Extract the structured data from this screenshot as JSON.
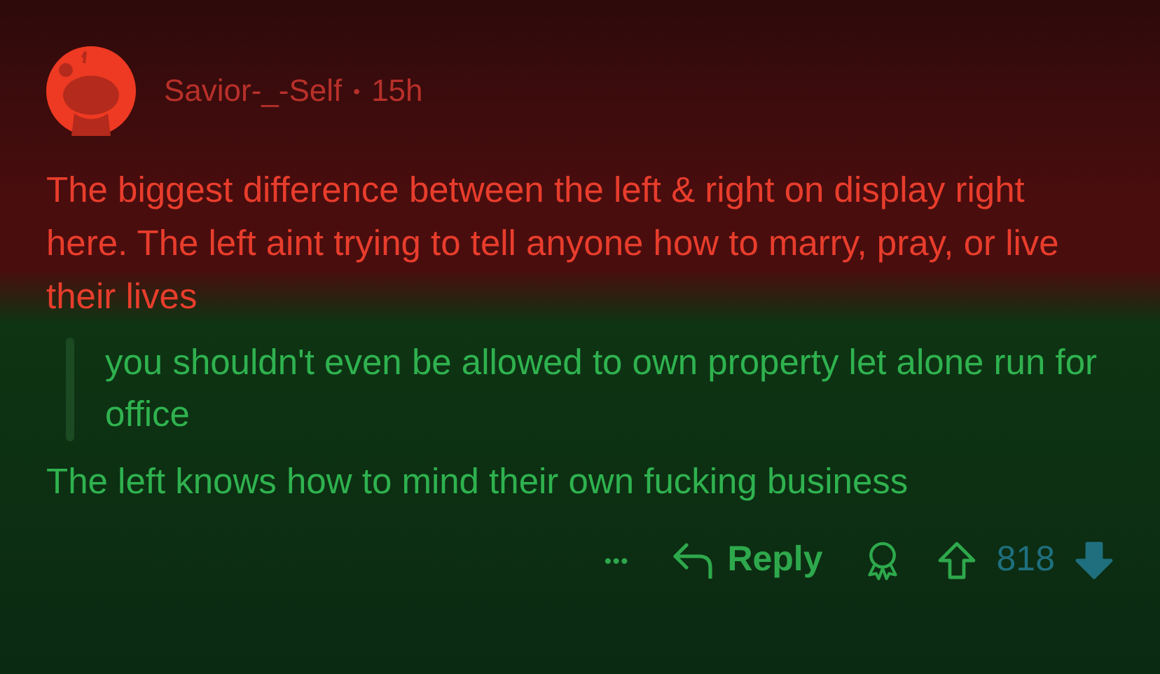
{
  "comment": {
    "author": "Savior-_-Self",
    "separator": "•",
    "age": "15h",
    "paragraphs": [
      {
        "kind": "text",
        "text": "The biggest difference between the left & right on display right here. The left aint trying to tell anyone how to marry, pray, or live their lives"
      },
      {
        "kind": "quote",
        "text": "you shouldn't even be allowed to own property let alone run for office"
      },
      {
        "kind": "text",
        "text": "The left knows how to mind their own fucking business"
      }
    ],
    "actions": {
      "more": "•••",
      "reply": "Reply",
      "score": "818",
      "upvoted": false,
      "downvoted": true
    }
  }
}
